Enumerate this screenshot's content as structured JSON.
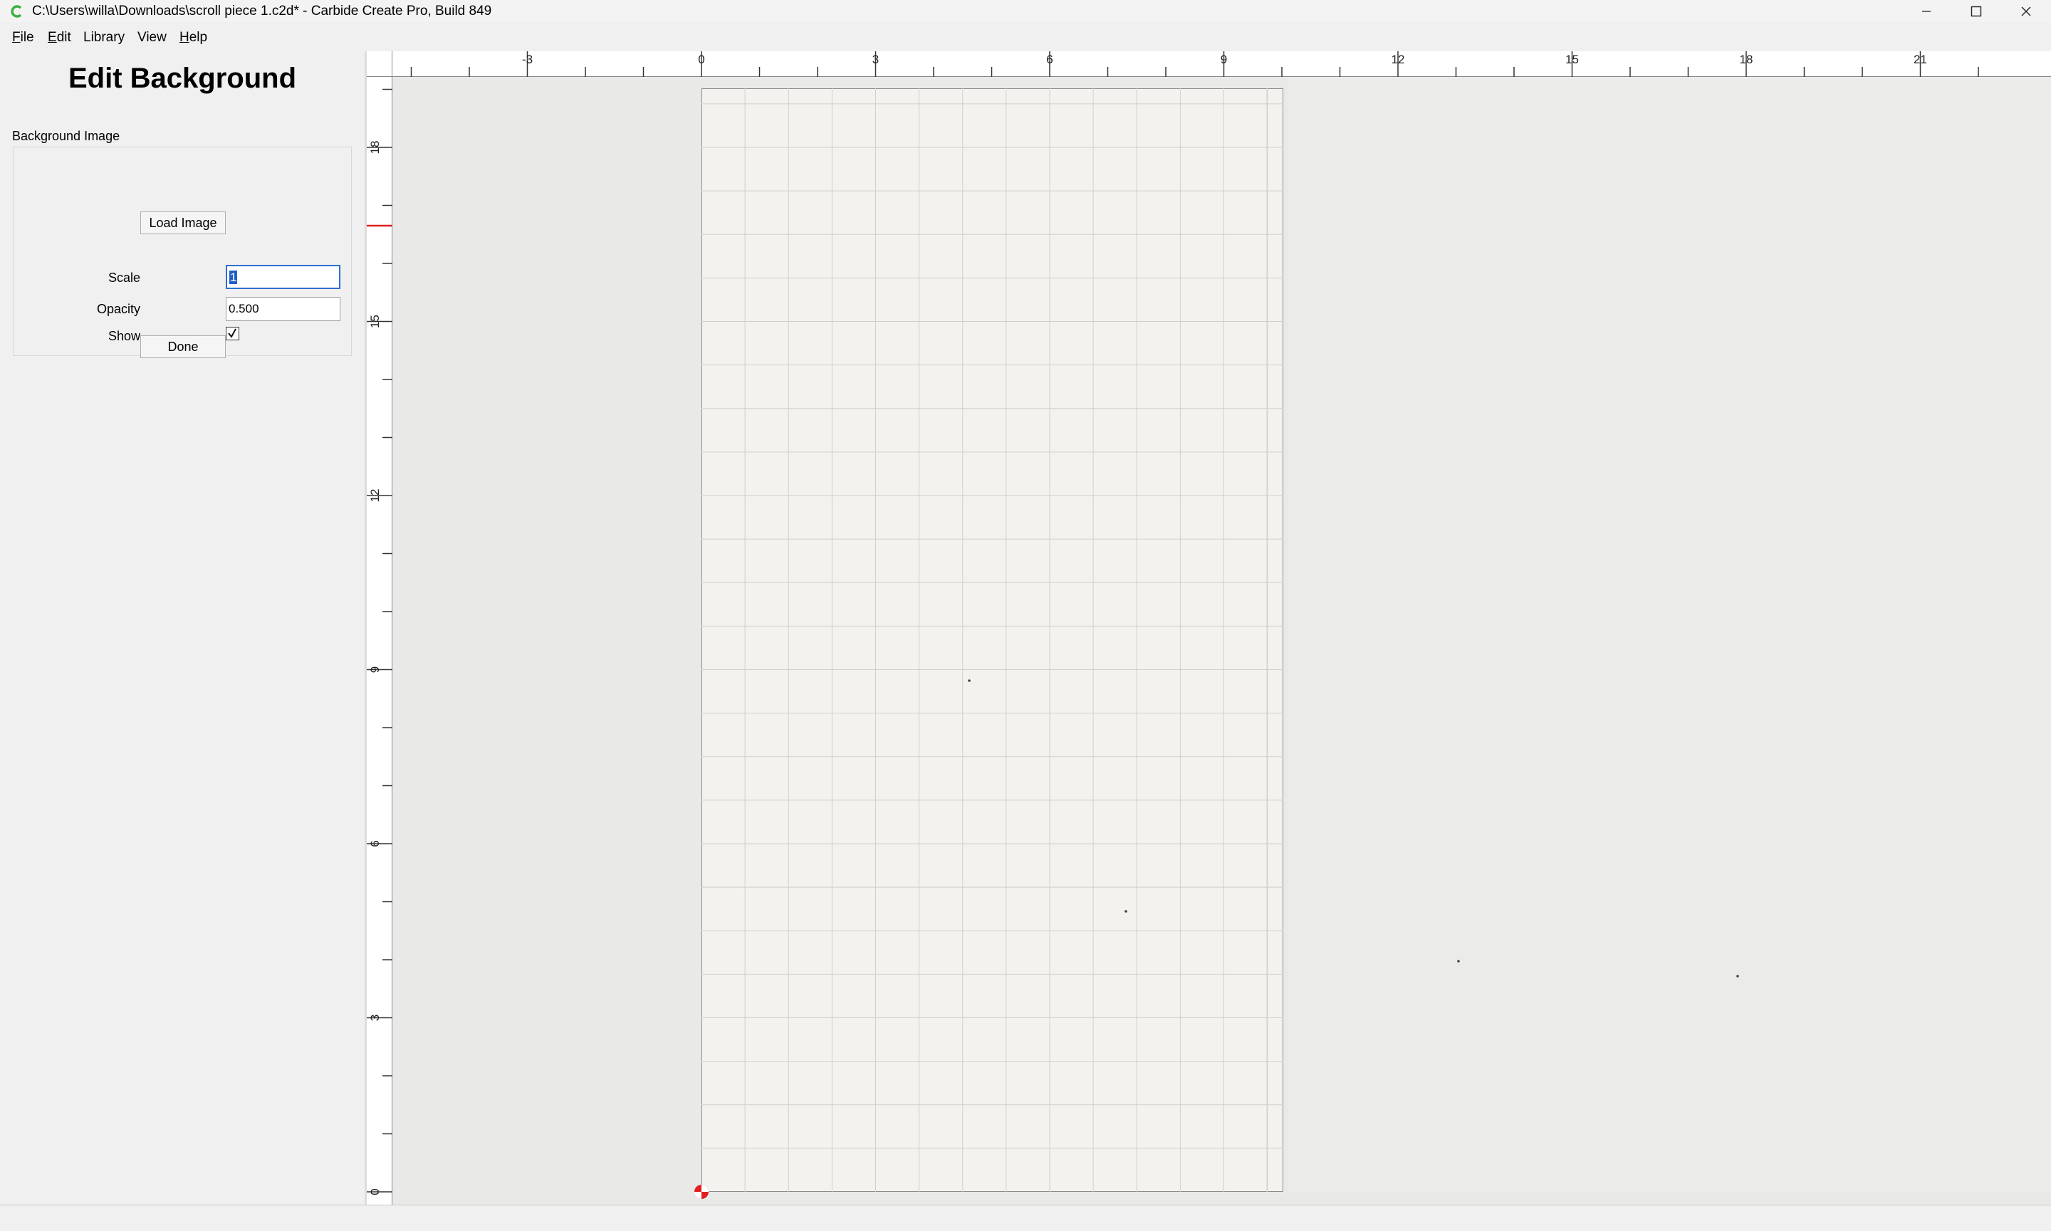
{
  "window": {
    "title": "C:\\Users\\willa\\Downloads\\scroll piece 1.c2d* - Carbide Create Pro, Build 849",
    "app_icon": "carbide-c-logo",
    "controls": [
      "minimize-icon",
      "maximize-icon",
      "close-icon"
    ]
  },
  "menu": {
    "file": {
      "mnemonic": "F",
      "rest": "ile"
    },
    "edit": {
      "mnemonic": "E",
      "rest": "dit"
    },
    "library": {
      "label": "Library"
    },
    "view": {
      "label": "View"
    },
    "help": {
      "mnemonic": "H",
      "rest": "elp"
    }
  },
  "panel": {
    "title": "Edit Background",
    "group_label": "Background Image",
    "load_button": "Load Image",
    "scale_label": "Scale",
    "scale_value": "1",
    "opacity_label": "Opacity",
    "opacity_value": "0.500",
    "show_label": "Show",
    "show_checked": true,
    "done_button": "Done"
  },
  "rulers": {
    "horizontal_ticks": [
      "-3",
      "0",
      "3",
      "6",
      "9",
      "12",
      "15",
      "18",
      "21"
    ],
    "vertical_ticks": [
      "0",
      "3",
      "6",
      "9",
      "12",
      "15",
      "18"
    ],
    "cursor_marker_color": "#e02020"
  },
  "colors": {
    "accent": "#1e5fc8",
    "origin_marker": "#e02020",
    "stock": "#f3f2ee",
    "grid": "#cfcfcb"
  }
}
